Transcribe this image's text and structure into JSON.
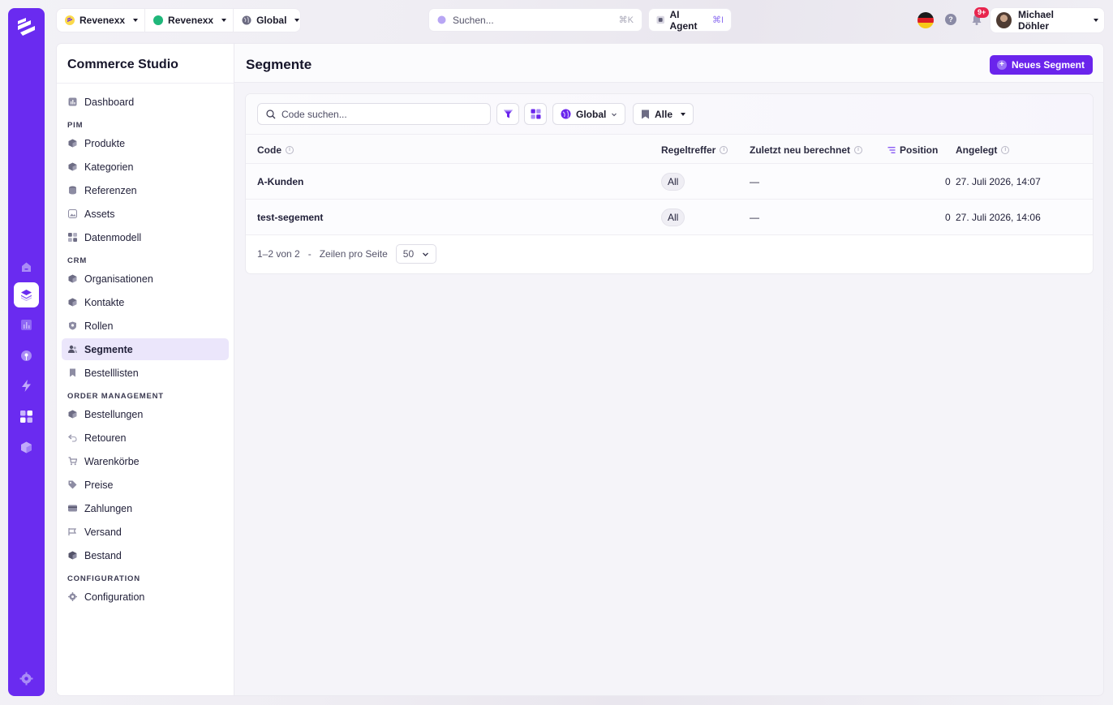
{
  "topbar": {
    "tenant": "Revenexx",
    "store": "Revenexx",
    "scope": "Global",
    "search_placeholder": "Suchen...",
    "search_shortcut": "⌘K",
    "ai_agent_label": "AI Agent",
    "ai_agent_shortcut": "⌘I",
    "help_label": "?",
    "notification_badge": "9+",
    "user_name": "Michael Döhler"
  },
  "sidebar": {
    "title": "Commerce Studio",
    "dashboard": "Dashboard",
    "sections": [
      {
        "heading": "PIM",
        "items": [
          "Produkte",
          "Kategorien",
          "Referenzen",
          "Assets",
          "Datenmodell"
        ]
      },
      {
        "heading": "CRM",
        "items": [
          "Organisationen",
          "Kontakte",
          "Rollen",
          "Segmente",
          "Bestelllisten"
        ]
      },
      {
        "heading": "ORDER MANAGEMENT",
        "items": [
          "Bestellungen",
          "Retouren",
          "Warenkörbe",
          "Preise",
          "Zahlungen",
          "Versand",
          "Bestand"
        ]
      },
      {
        "heading": "CONFIGURATION",
        "items": [
          "Configuration"
        ]
      }
    ],
    "active_item": "Segmente"
  },
  "page": {
    "title": "Segmente",
    "new_button": "Neues Segment"
  },
  "toolbar": {
    "code_search_placeholder": "Code suchen...",
    "scope_filter": "Global",
    "status_filter": "Alle"
  },
  "table": {
    "columns": [
      "Code",
      "Regeltreffer",
      "Zuletzt neu berechnet",
      "Position",
      "Angelegt"
    ],
    "rows": [
      {
        "code": "A-Kunden",
        "regeltreffer": "All",
        "zuletzt": "—",
        "position": "0",
        "angelegt": "27. Juli 2026, 14:07"
      },
      {
        "code": "test-segement",
        "regeltreffer": "All",
        "zuletzt": "—",
        "position": "0",
        "angelegt": "27. Juli 2026, 14:06"
      }
    ]
  },
  "pagination": {
    "range": "1–2 von 2",
    "separator": "-",
    "rows_per_page_label": "Zeilen pro Seite",
    "rows_per_page": "50"
  },
  "colors": {
    "brand": "#6a2bf0",
    "primary_button": "#6a24ec",
    "active_nav_bg": "#ebe6fb",
    "badge": "#e8254e"
  }
}
